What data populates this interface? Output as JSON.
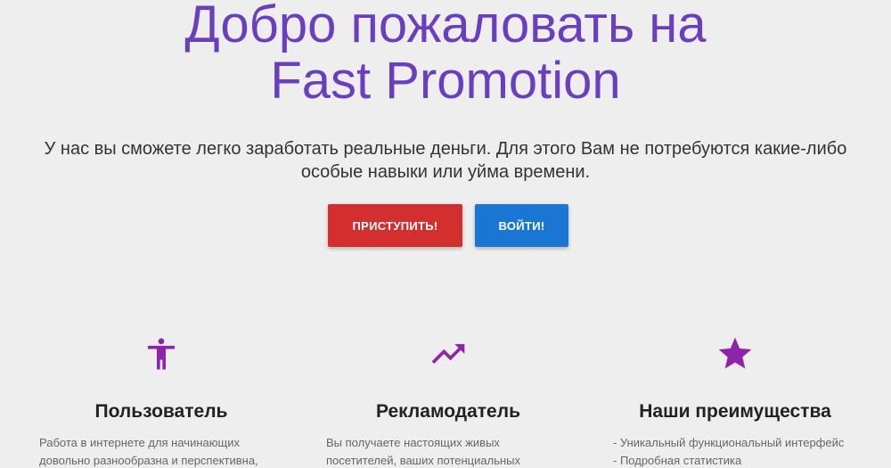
{
  "hero": {
    "title_line1": "Добро пожаловать на",
    "title_line2": "Fast Promotion",
    "subtitle": "У нас вы сможете легко заработать реальные деньги. Для этого Вам не потребуются какие-либо особые навыки или уйма времени."
  },
  "buttons": {
    "start_label": "ПРИСТУПИТЬ!",
    "login_label": "ВОЙТИ!"
  },
  "colors": {
    "title": "#6a3fbf",
    "icon": "#8e24aa",
    "start_button": "#d32f2f",
    "login_button": "#1976d2",
    "background": "#eeeeee"
  },
  "features": [
    {
      "icon": "person-icon",
      "title": "Пользователь",
      "lines": [
        "Работа в интернете для начинающих",
        "довольно разнообразна и перспективна,"
      ]
    },
    {
      "icon": "trending-up-icon",
      "title": "Рекламодатель",
      "lines": [
        "Вы получаете настоящих живых",
        "посетителей, ваших потенциальных"
      ]
    },
    {
      "icon": "star-icon",
      "title": "Наши преимущества",
      "lines": [
        "- Уникальный функциональный интерфейс",
        "- Подробная статистика"
      ]
    }
  ]
}
